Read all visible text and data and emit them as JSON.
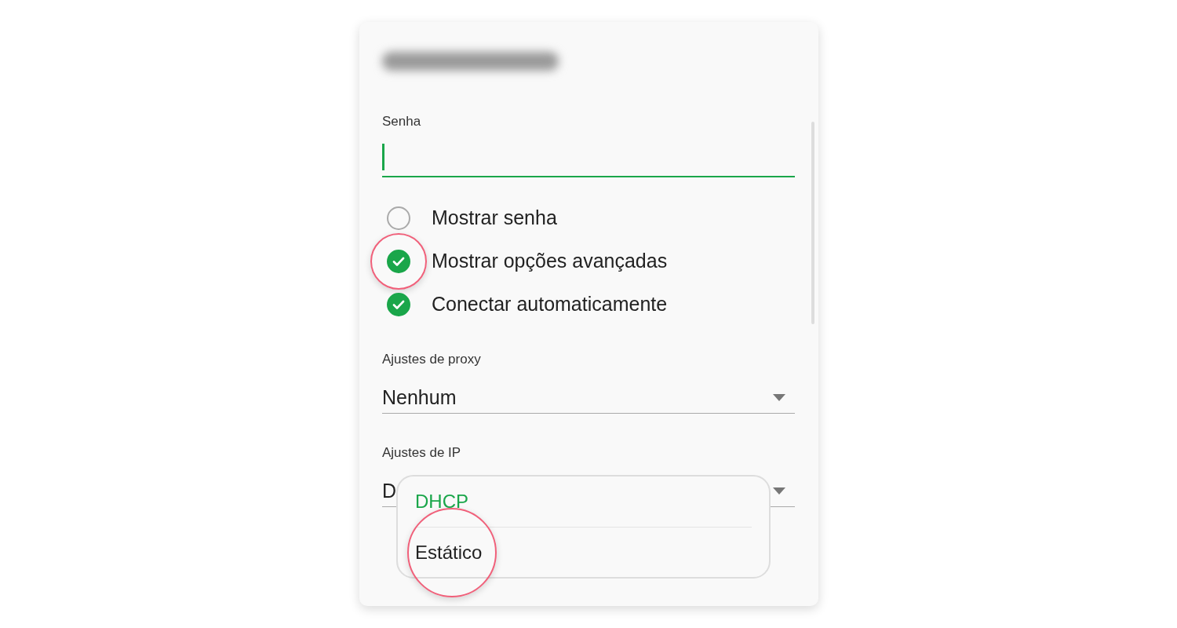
{
  "password": {
    "label": "Senha"
  },
  "options": [
    {
      "label": "Mostrar senha",
      "checked": false,
      "highlighted": false
    },
    {
      "label": "Mostrar opções avançadas",
      "checked": true,
      "highlighted": true
    },
    {
      "label": "Conectar automaticamente",
      "checked": true,
      "highlighted": false
    }
  ],
  "proxy": {
    "label": "Ajustes de proxy",
    "value": "Nenhum"
  },
  "ip": {
    "label": "Ajustes de IP",
    "value": "D",
    "menu": [
      {
        "label": "DHCP",
        "selected": true,
        "highlighted": false
      },
      {
        "label": "Estático",
        "selected": false,
        "highlighted": true
      }
    ]
  }
}
